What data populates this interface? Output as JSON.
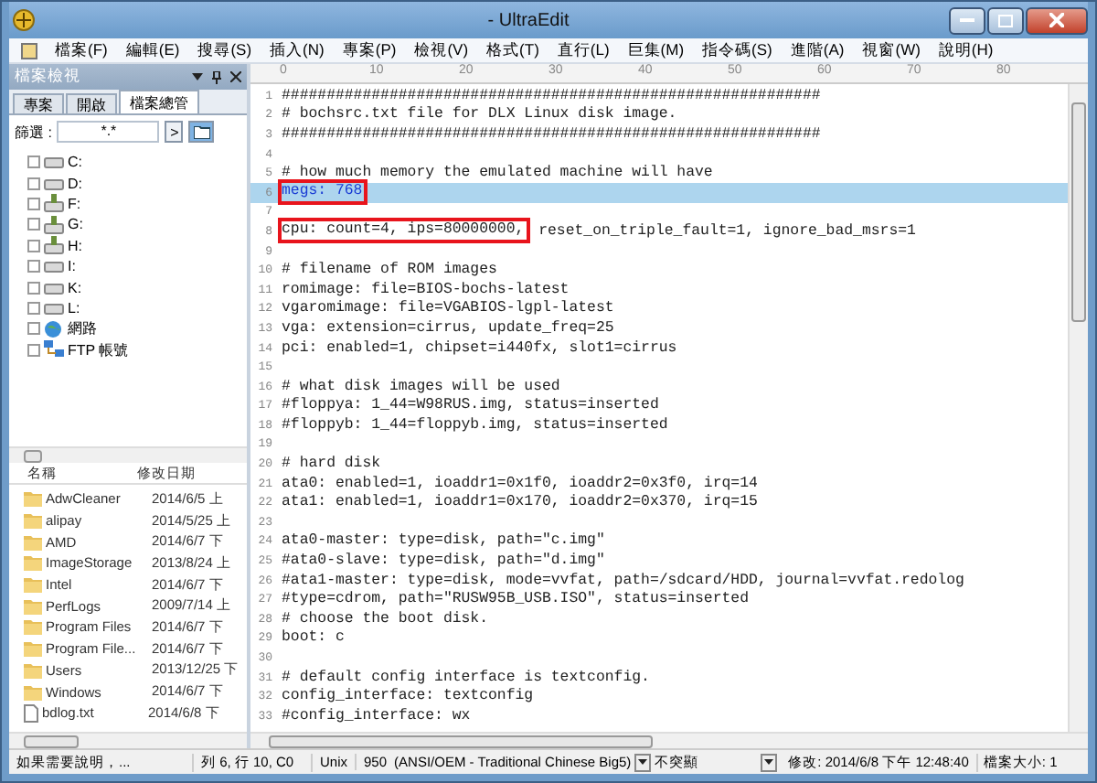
{
  "window": {
    "title": "- UltraEdit"
  },
  "menu": [
    "檔案(F)",
    "編輯(E)",
    "搜尋(S)",
    "插入(N)",
    "專案(P)",
    "檢視(V)",
    "格式(T)",
    "直行(L)",
    "巨集(M)",
    "指令碼(S)",
    "進階(A)",
    "視窗(W)",
    "說明(H)"
  ],
  "panel": {
    "title": "檔案檢視",
    "tabs": [
      {
        "label": "專案",
        "selected": false
      },
      {
        "label": "開啟",
        "selected": false
      },
      {
        "label": "檔案總管",
        "selected": true
      }
    ],
    "filter": {
      "label": "篩選 :",
      "value": "*.*",
      "go": ">"
    },
    "tree": [
      {
        "label": "C:",
        "kind": "drive"
      },
      {
        "label": "D:",
        "kind": "drive"
      },
      {
        "label": "F:",
        "kind": "netdrive"
      },
      {
        "label": "G:",
        "kind": "netdrive"
      },
      {
        "label": "H:",
        "kind": "netdrive"
      },
      {
        "label": "I:",
        "kind": "drive"
      },
      {
        "label": "K:",
        "kind": "drive"
      },
      {
        "label": "L:",
        "kind": "drive"
      },
      {
        "label": "網路",
        "kind": "network"
      },
      {
        "label": "FTP 帳號",
        "kind": "ftp"
      }
    ],
    "files": {
      "columns": [
        "名稱",
        "修改日期"
      ],
      "rows": [
        {
          "name": "AdwCleaner",
          "date": "2014/6/5 上",
          "kind": "folder"
        },
        {
          "name": "alipay",
          "date": "2014/5/25 上",
          "kind": "folder"
        },
        {
          "name": "AMD",
          "date": "2014/6/7 下",
          "kind": "folder"
        },
        {
          "name": "ImageStorage",
          "date": "2013/8/24 上",
          "kind": "folder"
        },
        {
          "name": "Intel",
          "date": "2014/6/7 下",
          "kind": "folder"
        },
        {
          "name": "PerfLogs",
          "date": "2009/7/14 上",
          "kind": "folder"
        },
        {
          "name": "Program Files",
          "date": "2014/6/7 下",
          "kind": "folder"
        },
        {
          "name": "Program File...",
          "date": "2014/6/7 下",
          "kind": "folder"
        },
        {
          "name": "Users",
          "date": "2013/12/25 下",
          "kind": "folder"
        },
        {
          "name": "Windows",
          "date": "2014/6/7 下",
          "kind": "folder"
        },
        {
          "name": "bdlog.txt",
          "date": "2014/6/8 下",
          "kind": "file"
        }
      ]
    }
  },
  "ruler": [
    "0",
    "10",
    "20",
    "30",
    "40",
    "50",
    "60",
    "70",
    "80"
  ],
  "lines": [
    {
      "n": "1",
      "text": "############################################################"
    },
    {
      "n": "2",
      "text": "# bochsrc.txt file for DLX Linux disk image."
    },
    {
      "n": "3",
      "text": "############################################################"
    },
    {
      "n": "4"
    },
    {
      "n": "5",
      "text": "# how much memory the emulated machine will have"
    },
    {
      "n": "6",
      "marked": "megs: 768",
      "selected": true
    },
    {
      "n": "7"
    },
    {
      "n": "8",
      "marked": "cpu: count=4, ips=80000000,",
      "text": " reset_on_triple_fault=1, ignore_bad_msrs=1"
    },
    {
      "n": "9"
    },
    {
      "n": "10",
      "text": "# filename of ROM images"
    },
    {
      "n": "11",
      "text": "romimage: file=BIOS-bochs-latest"
    },
    {
      "n": "12",
      "text": "vgaromimage: file=VGABIOS-lgpl-latest"
    },
    {
      "n": "13",
      "text": "vga: extension=cirrus, update_freq=25"
    },
    {
      "n": "14",
      "text": "pci: enabled=1, chipset=i440fx, slot1=cirrus"
    },
    {
      "n": "15"
    },
    {
      "n": "16",
      "text": "# what disk images will be used"
    },
    {
      "n": "17",
      "text": "#floppya: 1_44=W98RUS.img, status=inserted"
    },
    {
      "n": "18",
      "text": "#floppyb: 1_44=floppyb.img, status=inserted"
    },
    {
      "n": "19"
    },
    {
      "n": "20",
      "text": "# hard disk"
    },
    {
      "n": "21",
      "text": "ata0: enabled=1, ioaddr1=0x1f0, ioaddr2=0x3f0, irq=14"
    },
    {
      "n": "22",
      "text": "ata1: enabled=1, ioaddr1=0x170, ioaddr2=0x370, irq=15"
    },
    {
      "n": "23"
    },
    {
      "n": "24",
      "text": "ata0-master: type=disk, path=\"c.img\""
    },
    {
      "n": "25",
      "text": "#ata0-slave: type=disk, path=\"d.img\""
    },
    {
      "n": "26",
      "text": "#ata1-master: type=disk, mode=vvfat, path=/sdcard/HDD, journal=vvfat.redolog"
    },
    {
      "n": "27",
      "text": "#type=cdrom, path=\"RUSW95B_USB.ISO\", status=inserted"
    },
    {
      "n": "28",
      "text": "# choose the boot disk."
    },
    {
      "n": "29",
      "text": "boot: c"
    },
    {
      "n": "30"
    },
    {
      "n": "31",
      "text": "# default config interface is textconfig."
    },
    {
      "n": "32",
      "text": "config_interface: textconfig"
    },
    {
      "n": "33",
      "text": "#config_interface: wx"
    }
  ],
  "status_bar": {
    "help": "如果需要說明，...",
    "position": "列 6, 行 10, C0",
    "line_ending": "Unix",
    "codepage": "950",
    "encoding": "(ANSI/OEM - Traditional Chinese Big5)",
    "highlight": "不突顯",
    "modified": "修改: 2014/6/8 下午 12:48:40",
    "size": "檔案大小: 1"
  }
}
